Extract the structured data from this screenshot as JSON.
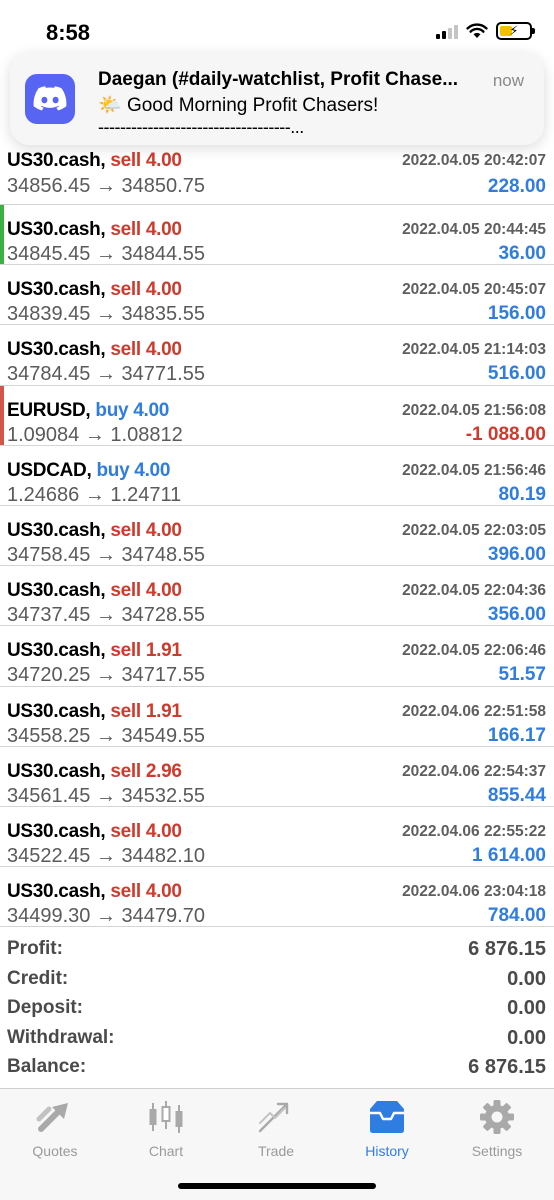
{
  "status_bar": {
    "time": "8:58",
    "battery": "⚡"
  },
  "notification": {
    "title": "Daegan (#daily-watchlist, Profit Chase...",
    "time": "now",
    "line1": "Good Morning Profit Chasers!",
    "emoji": "🌤️",
    "line2": "-----------------------------------..."
  },
  "deals": [
    {
      "symbol": "US30.cash,",
      "side": "sell",
      "volume": "sell 4.00",
      "datetime": "2022.04.05 20:42:07",
      "prices": "34856.45 → 34850.75",
      "profit": "228.00",
      "profit_sign": "pos",
      "marker": ""
    },
    {
      "symbol": "US30.cash,",
      "side": "sell",
      "volume": "sell 4.00",
      "datetime": "2022.04.05 20:44:45",
      "prices": "34845.45 → 34844.55",
      "profit": "36.00",
      "profit_sign": "pos",
      "marker": "#3cb043"
    },
    {
      "symbol": "US30.cash,",
      "side": "sell",
      "volume": "sell 4.00",
      "datetime": "2022.04.05 20:45:07",
      "prices": "34839.45 → 34835.55",
      "profit": "156.00",
      "profit_sign": "pos",
      "marker": ""
    },
    {
      "symbol": "US30.cash,",
      "side": "sell",
      "volume": "sell 4.00",
      "datetime": "2022.04.05 21:14:03",
      "prices": "34784.45 → 34771.55",
      "profit": "516.00",
      "profit_sign": "pos",
      "marker": ""
    },
    {
      "symbol": "EURUSD,",
      "side": "buy",
      "volume": "buy 4.00",
      "datetime": "2022.04.05 21:56:08",
      "prices": "1.09084 → 1.08812",
      "profit": "-1 088.00",
      "profit_sign": "neg",
      "marker": "#d0574a"
    },
    {
      "symbol": "USDCAD,",
      "side": "buy",
      "volume": "buy 4.00",
      "datetime": "2022.04.05 21:56:46",
      "prices": "1.24686 → 1.24711",
      "profit": "80.19",
      "profit_sign": "pos",
      "marker": ""
    },
    {
      "symbol": "US30.cash,",
      "side": "sell",
      "volume": "sell 4.00",
      "datetime": "2022.04.05 22:03:05",
      "prices": "34758.45 → 34748.55",
      "profit": "396.00",
      "profit_sign": "pos",
      "marker": ""
    },
    {
      "symbol": "US30.cash,",
      "side": "sell",
      "volume": "sell 4.00",
      "datetime": "2022.04.05 22:04:36",
      "prices": "34737.45 → 34728.55",
      "profit": "356.00",
      "profit_sign": "pos",
      "marker": ""
    },
    {
      "symbol": "US30.cash,",
      "side": "sell",
      "volume": "sell 1.91",
      "datetime": "2022.04.05 22:06:46",
      "prices": "34720.25 → 34717.55",
      "profit": "51.57",
      "profit_sign": "pos",
      "marker": ""
    },
    {
      "symbol": "US30.cash,",
      "side": "sell",
      "volume": "sell 1.91",
      "datetime": "2022.04.06 22:51:58",
      "prices": "34558.25 → 34549.55",
      "profit": "166.17",
      "profit_sign": "pos",
      "marker": ""
    },
    {
      "symbol": "US30.cash,",
      "side": "sell",
      "volume": "sell 2.96",
      "datetime": "2022.04.06 22:54:37",
      "prices": "34561.45 → 34532.55",
      "profit": "855.44",
      "profit_sign": "pos",
      "marker": ""
    },
    {
      "symbol": "US30.cash,",
      "side": "sell",
      "volume": "sell 4.00",
      "datetime": "2022.04.06 22:55:22",
      "prices": "34522.45 → 34482.10",
      "profit": "1 614.00",
      "profit_sign": "pos",
      "marker": ""
    },
    {
      "symbol": "US30.cash,",
      "side": "sell",
      "volume": "sell 4.00",
      "datetime": "2022.04.06 23:04:18",
      "prices": "34499.30 → 34479.70",
      "profit": "784.00",
      "profit_sign": "pos",
      "marker": ""
    }
  ],
  "summary": [
    {
      "label": "Profit:",
      "value": "6 876.15"
    },
    {
      "label": "Credit:",
      "value": "0.00"
    },
    {
      "label": "Deposit:",
      "value": "0.00"
    },
    {
      "label": "Withdrawal:",
      "value": "0.00"
    },
    {
      "label": "Balance:",
      "value": "6 876.15"
    }
  ],
  "tabs": [
    {
      "label": "Quotes",
      "icon": "quotes-icon",
      "active": false
    },
    {
      "label": "Chart",
      "icon": "chart-icon",
      "active": false
    },
    {
      "label": "Trade",
      "icon": "trade-icon",
      "active": false
    },
    {
      "label": "History",
      "icon": "history-icon",
      "active": true
    },
    {
      "label": "Settings",
      "icon": "settings-icon",
      "active": false
    }
  ],
  "colors": {
    "sell": "#d03a2c",
    "buy": "#2f7de1",
    "positive": "#2f7de1",
    "negative": "#d03a2c",
    "active_tab": "#2f7de1",
    "discord": "#5865f2"
  }
}
